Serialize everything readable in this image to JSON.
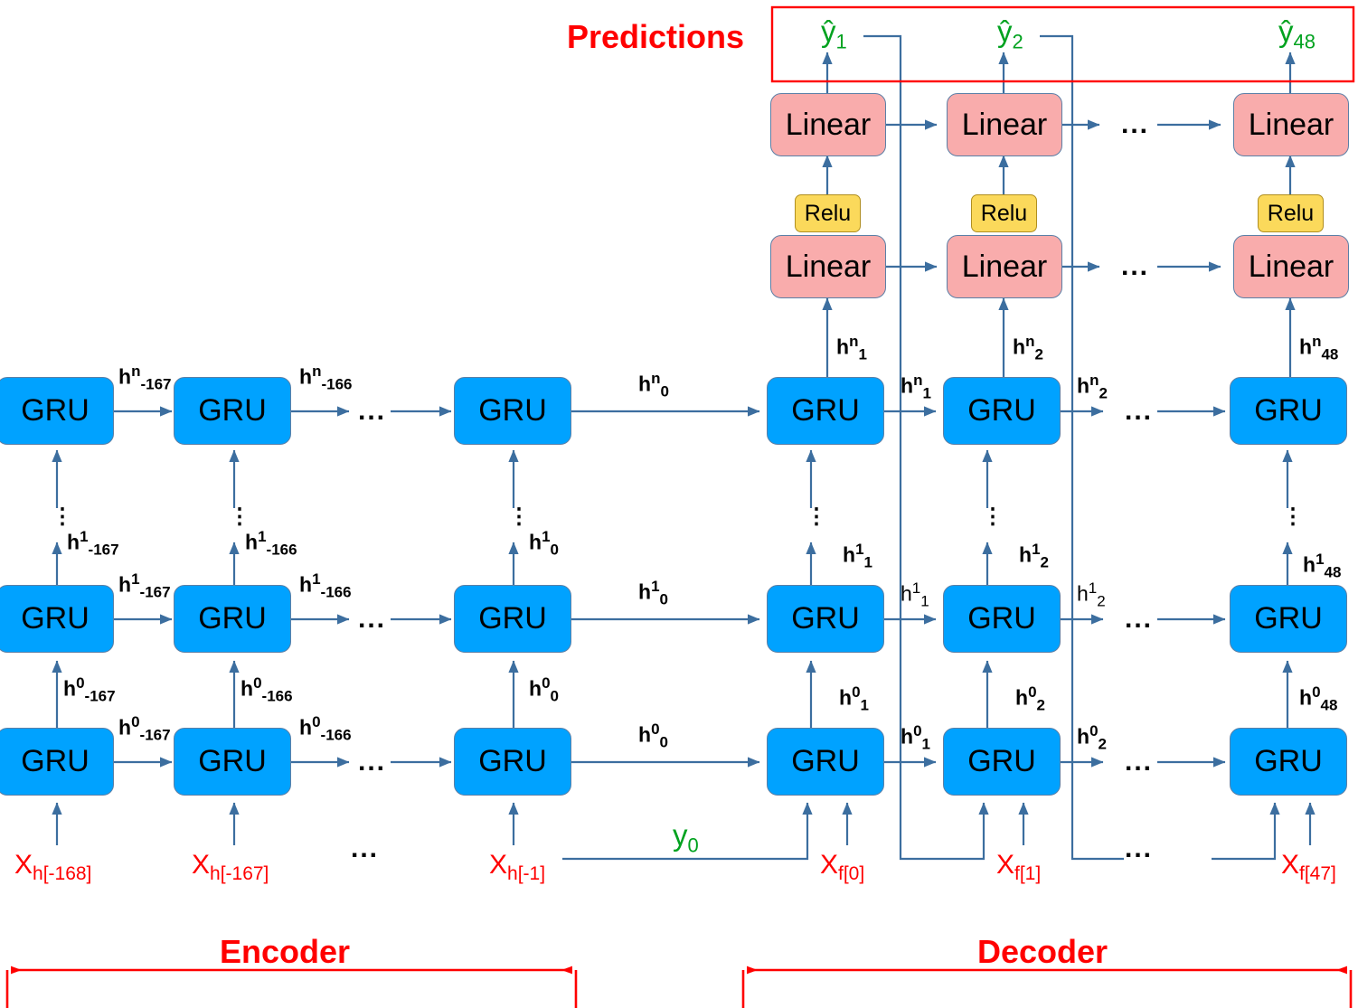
{
  "diagram": {
    "title_predictions": "Predictions",
    "encoder_label": "Encoder",
    "decoder_label": "Decoder",
    "ellipsis": "...",
    "vertical_ellipsis": "⋮",
    "colors": {
      "gru_fill": "#00A2FF",
      "linear_fill": "#F9ACAC",
      "relu_fill": "#FBD95B",
      "arrow": "#3C6E9F",
      "red": "#FF0000",
      "green": "#00A21F"
    }
  },
  "blocks": {
    "gru_label": "GRU",
    "linear_label": "Linear",
    "relu_label": "Relu"
  },
  "encoder": {
    "columns": [
      {
        "input": {
          "base": "X",
          "sub": "h[-168]"
        }
      },
      {
        "input": {
          "base": "X",
          "sub": "h[-167]"
        }
      },
      {
        "input": {
          "base": "X",
          "sub": "h[-1]"
        }
      }
    ],
    "hidden_labels": {
      "layer0_horizontal": [
        {
          "base": "h",
          "sup": "0",
          "sub": "-167"
        },
        {
          "base": "h",
          "sup": "0",
          "sub": "-166"
        },
        {
          "base": "h",
          "sup": "0",
          "sub": "0"
        }
      ],
      "layer0_vertical": [
        {
          "base": "h",
          "sup": "0",
          "sub": "-167"
        },
        {
          "base": "h",
          "sup": "0",
          "sub": "-166"
        },
        {
          "base": "h",
          "sup": "0",
          "sub": "0"
        }
      ],
      "layer1_horizontal": [
        {
          "base": "h",
          "sup": "1",
          "sub": "-167"
        },
        {
          "base": "h",
          "sup": "1",
          "sub": "-166"
        },
        {
          "base": "h",
          "sup": "1",
          "sub": "0"
        }
      ],
      "layer1_vertical": [
        {
          "base": "h",
          "sup": "1",
          "sub": "-167"
        },
        {
          "base": "h",
          "sup": "1",
          "sub": "-166"
        },
        {
          "base": "h",
          "sup": "1",
          "sub": "0"
        }
      ],
      "layern_horizontal": [
        {
          "base": "h",
          "sup": "n",
          "sub": "-167"
        },
        {
          "base": "h",
          "sup": "n",
          "sub": "-166"
        },
        {
          "base": "h",
          "sup": "n",
          "sub": "0"
        }
      ]
    }
  },
  "decoder": {
    "columns": [
      {
        "input": {
          "base": "X",
          "sub": "f[0]"
        }
      },
      {
        "input": {
          "base": "X",
          "sub": "f[1]"
        }
      },
      {
        "input": {
          "base": "X",
          "sub": "f[47]"
        }
      }
    ],
    "teacher_input": {
      "base": "y",
      "sub": "0"
    },
    "predictions": [
      {
        "base": "ŷ",
        "sub": "1"
      },
      {
        "base": "ŷ",
        "sub": "2"
      },
      {
        "base": "ŷ",
        "sub": "48"
      }
    ],
    "hidden_labels": {
      "layer0_vertical": [
        {
          "base": "h",
          "sup": "0",
          "sub": "1"
        },
        {
          "base": "h",
          "sup": "0",
          "sub": "2"
        },
        {
          "base": "h",
          "sup": "0",
          "sub": "48"
        }
      ],
      "layer0_horizontal": [
        {
          "base": "h",
          "sup": "0",
          "sub": "1"
        },
        {
          "base": "h",
          "sup": "0",
          "sub": "2"
        }
      ],
      "layer1_vertical": [
        {
          "base": "h",
          "sup": "1",
          "sub": "1"
        },
        {
          "base": "h",
          "sup": "1",
          "sub": "2"
        },
        {
          "base": "h",
          "sup": "1",
          "sub": "48"
        }
      ],
      "layer1_horizontal": [
        {
          "base": "h",
          "sup": "1",
          "sub": "1"
        },
        {
          "base": "h",
          "sup": "1",
          "sub": "2"
        }
      ],
      "layern_vertical": [
        {
          "base": "h",
          "sup": "n",
          "sub": "1"
        },
        {
          "base": "h",
          "sup": "n",
          "sub": "2"
        },
        {
          "base": "h",
          "sup": "n",
          "sub": "48"
        }
      ],
      "layern_horizontal": [
        {
          "base": "h",
          "sup": "n",
          "sub": "1"
        },
        {
          "base": "h",
          "sup": "n",
          "sub": "2"
        }
      ]
    }
  }
}
